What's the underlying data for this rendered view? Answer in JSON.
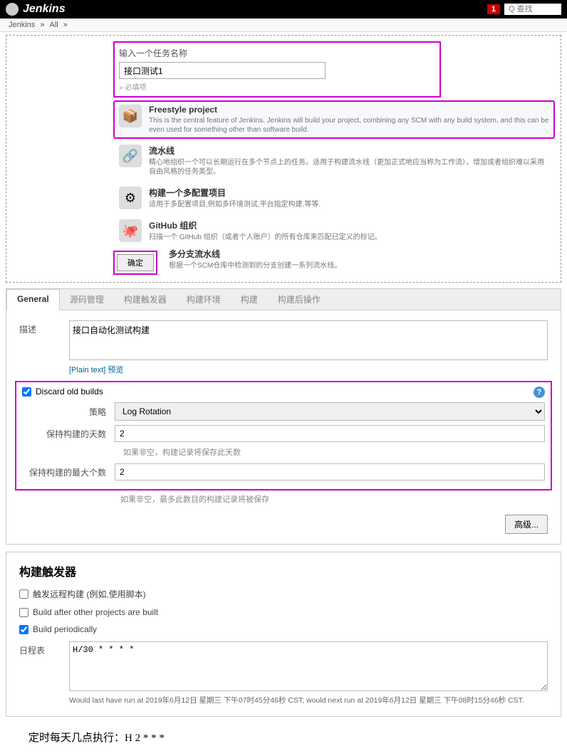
{
  "topbar": {
    "brand": "Jenkins",
    "alert_count": "1",
    "search_placeholder": "Q 查找"
  },
  "breadcrumb": {
    "a": "Jenkins",
    "b": "All"
  },
  "new_item": {
    "label": "输入一个任务名称",
    "value": "接口测试1",
    "required": "» 必填项"
  },
  "options": {
    "freestyle": {
      "title": "Freestyle project",
      "desc": "This is the central feature of Jenkins. Jenkins will build your project, combining any SCM with any build system, and this can be even used for something other than software build."
    },
    "pipeline": {
      "title": "流水线",
      "desc": "精心地组织一个可以长期运行在多个节点上的任务。适用于构建流水线（更加正式地应当称为工作流），增加或者组织难以采用自由风格的任务类型。"
    },
    "multi": {
      "title": "构建一个多配置项目",
      "desc": "适用于多配置项目,例如多环境测试,平台指定构建,等等."
    },
    "github": {
      "title": "GitHub 组织",
      "desc": "扫描一个 GitHub 组织（或者个人账户）的所有仓库来匹配已定义的标记。"
    },
    "mbpipe": {
      "title": "多分支流水线",
      "desc": "根据一个SCM仓库中检测到的分支创建一系列流水线。"
    }
  },
  "ok_label": "确定",
  "config": {
    "tabs": [
      "General",
      "源码管理",
      "构建触发器",
      "构建环境",
      "构建",
      "构建后操作"
    ],
    "desc_label": "描述",
    "desc_value": "接口自动化测试构建",
    "plain_text": "[Plain text] 预览",
    "discard": {
      "label": "Discard old builds",
      "strategy_label": "策略",
      "strategy_value": "Log Rotation",
      "days_label": "保持构建的天数",
      "days_value": "2",
      "days_hint": "如果非空，构建记录将保存此天数",
      "max_label": "保持构建的最大个数",
      "max_value": "2",
      "max_hint": "如果非空，最多此数目的构建记录将被保存"
    },
    "advanced_label": "高级..."
  },
  "triggers": {
    "heading": "构建触发器",
    "remote": "触发远程构建 (例如,使用脚本)",
    "after": "Build after other projects are built",
    "periodic": "Build periodically",
    "sched_label": "日程表",
    "sched_value": "H/30 * * * *",
    "sched_note": "Would last have run at 2019年6月12日 星期三 下午07时45分46秒 CST; would next run at 2019年6月12日 星期三 下午08时15分46秒 CST."
  },
  "footer": "定时每天几点执行：H 2 * * *"
}
